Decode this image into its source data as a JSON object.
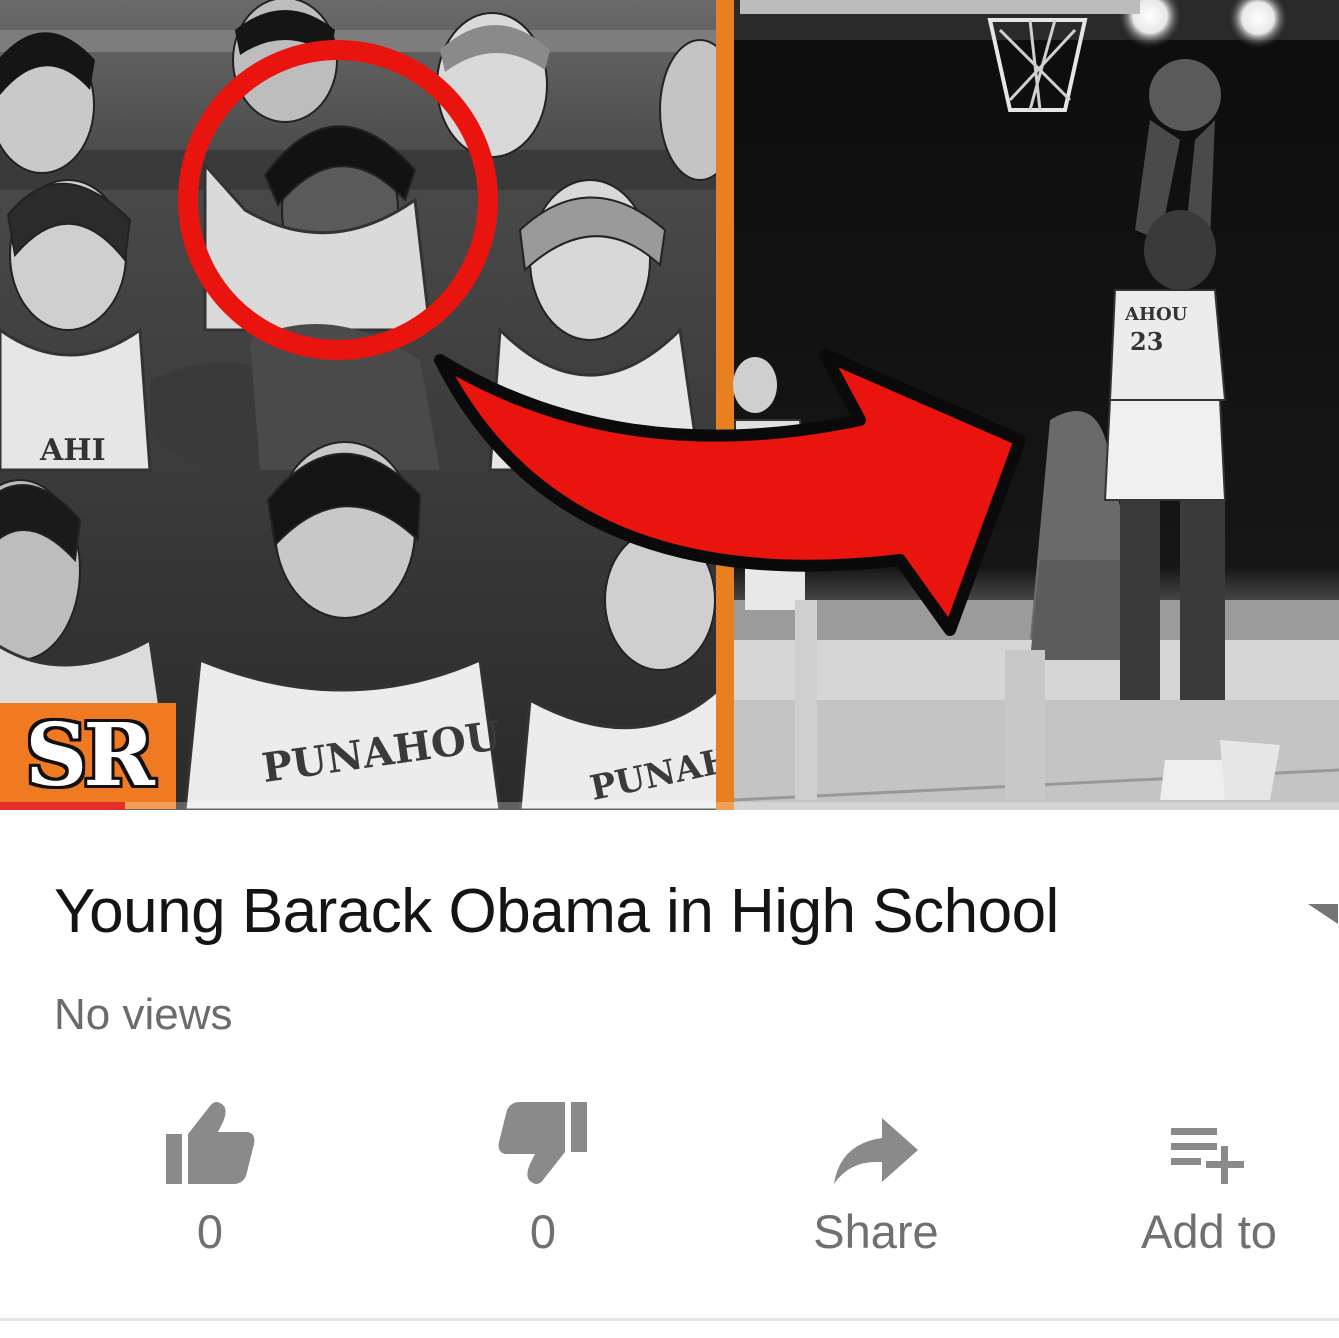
{
  "video": {
    "thumbnail_alt": "",
    "channel_badge": "SR",
    "progress_percent": 9.3,
    "jersey_text": [
      "PUNAHOU",
      "AHOU",
      "23"
    ]
  },
  "info": {
    "title": "Young Barack Obama in High School",
    "views": "No views"
  },
  "actions": [
    {
      "name": "like",
      "icon": "thumbs-up-icon",
      "label": "0"
    },
    {
      "name": "dislike",
      "icon": "thumbs-down-icon",
      "label": "0"
    },
    {
      "name": "share",
      "icon": "share-arrow-icon",
      "label": "Share"
    },
    {
      "name": "add-to",
      "icon": "playlist-add-icon",
      "label": "Add to"
    }
  ],
  "colors": {
    "accent_red": "#e52d27",
    "badge_orange": "#f07a22",
    "icon_gray": "#8a8a8a"
  }
}
